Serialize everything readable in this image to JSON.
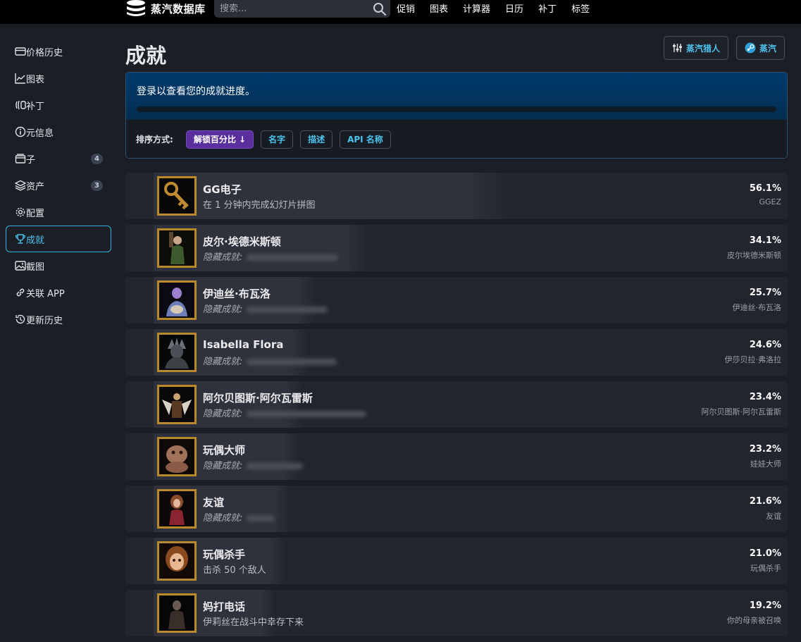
{
  "header": {
    "logo_text": "蒸汽数据库",
    "search_placeholder": "搜索...",
    "nav": [
      "促销",
      "图表",
      "计算器",
      "日历",
      "补丁",
      "标签"
    ]
  },
  "sidebar": {
    "items": [
      {
        "label": "价格历史",
        "icon": "price-history-icon"
      },
      {
        "label": "图表",
        "icon": "chart-icon"
      },
      {
        "label": "补丁",
        "icon": "patch-icon"
      },
      {
        "label": "元信息",
        "icon": "info-icon"
      },
      {
        "label": "子",
        "icon": "package-icon",
        "badge": "4"
      },
      {
        "label": "资产",
        "icon": "layers-icon",
        "badge": "3"
      },
      {
        "label": "配置",
        "icon": "gear-icon"
      },
      {
        "label": "成就",
        "icon": "trophy-icon",
        "active": true
      },
      {
        "label": "截图",
        "icon": "image-icon"
      },
      {
        "label": "关联 APP",
        "icon": "link-icon"
      },
      {
        "label": "更新历史",
        "icon": "history-icon"
      }
    ]
  },
  "page": {
    "title": "成就",
    "buttons": {
      "steamhunters": "蒸汽猎人",
      "steam": "蒸汽"
    }
  },
  "progress": {
    "message": "登录以查看您的成就进度。",
    "fraction": 0
  },
  "sort": {
    "label": "排序方式:",
    "options": [
      "解锁百分比 ↓",
      "名字",
      "描述",
      "API 名称"
    ],
    "active_index": 0
  },
  "hidden_prefix": "隐藏成就:",
  "achievements": [
    {
      "name": "GG电子",
      "desc": "在 1 分钟内完成幻灯片拼图",
      "hidden": false,
      "percent": "56.1%",
      "percent_value": 56.1,
      "api": "GGEZ",
      "icon": "key-icon"
    },
    {
      "name": "皮尔·埃德米斯顿",
      "hidden": true,
      "percent": "34.1%",
      "percent_value": 34.1,
      "api": "皮尔埃德米斯顿",
      "icon": "green-figure-icon"
    },
    {
      "name": "伊迪丝·布瓦洛",
      "hidden": true,
      "percent": "25.7%",
      "percent_value": 25.7,
      "api": "伊迪丝·布瓦洛",
      "icon": "purple-figure-icon"
    },
    {
      "name": "Isabella Flora",
      "hidden": true,
      "percent": "24.6%",
      "percent_value": 24.6,
      "api": "伊莎贝拉·弗洛拉",
      "icon": "dark-creature-icon"
    },
    {
      "name": "阿尔贝图斯·阿尔瓦雷斯",
      "hidden": true,
      "percent": "23.4%",
      "percent_value": 23.4,
      "api": "阿尔贝图斯·阿尔瓦雷斯",
      "icon": "winged-figure-icon"
    },
    {
      "name": "玩偶大师",
      "hidden": true,
      "percent": "23.2%",
      "percent_value": 23.2,
      "api": "娃娃大师",
      "icon": "doll-master-icon"
    },
    {
      "name": "友谊",
      "hidden": true,
      "percent": "21.6%",
      "percent_value": 21.6,
      "api": "友谊",
      "icon": "red-doll-icon"
    },
    {
      "name": "玩偶杀手",
      "desc": "击杀 50 个敌人",
      "hidden": false,
      "percent": "21.0%",
      "percent_value": 21.0,
      "api": "玩偶杀手",
      "icon": "doll-face-icon"
    },
    {
      "name": "妈打电话",
      "desc": "伊莉丝在战斗中幸存下来",
      "hidden": false,
      "percent": "19.2%",
      "percent_value": 19.2,
      "api": "你的母亲被召唤",
      "icon": "shadow-figure-icon"
    }
  ]
}
